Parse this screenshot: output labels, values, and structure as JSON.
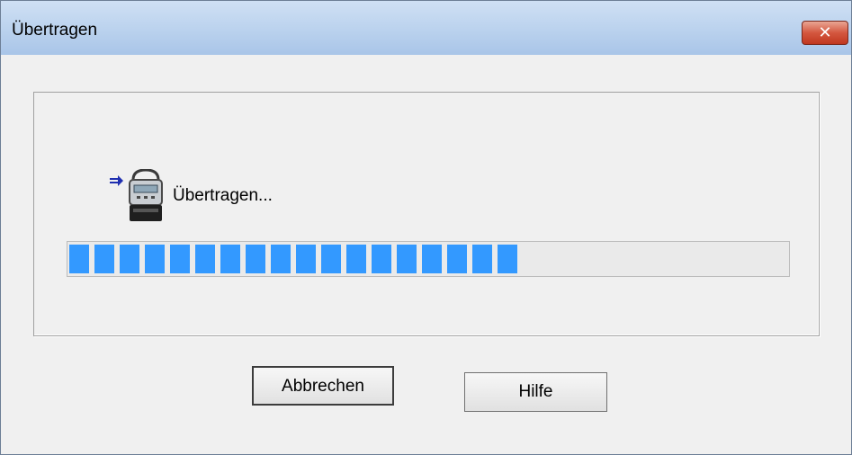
{
  "window": {
    "title": "Übertragen"
  },
  "titlebar": {
    "close_icon": "close-icon"
  },
  "main": {
    "device_icon": "transfer-device-icon",
    "status_text": "Übertragen...",
    "progress_percent": 63
  },
  "buttons": {
    "cancel_label": "Abbrechen",
    "help_label": "Hilfe"
  },
  "colors": {
    "progress_fill": "#3399ff",
    "close_red": "#c0371f"
  }
}
